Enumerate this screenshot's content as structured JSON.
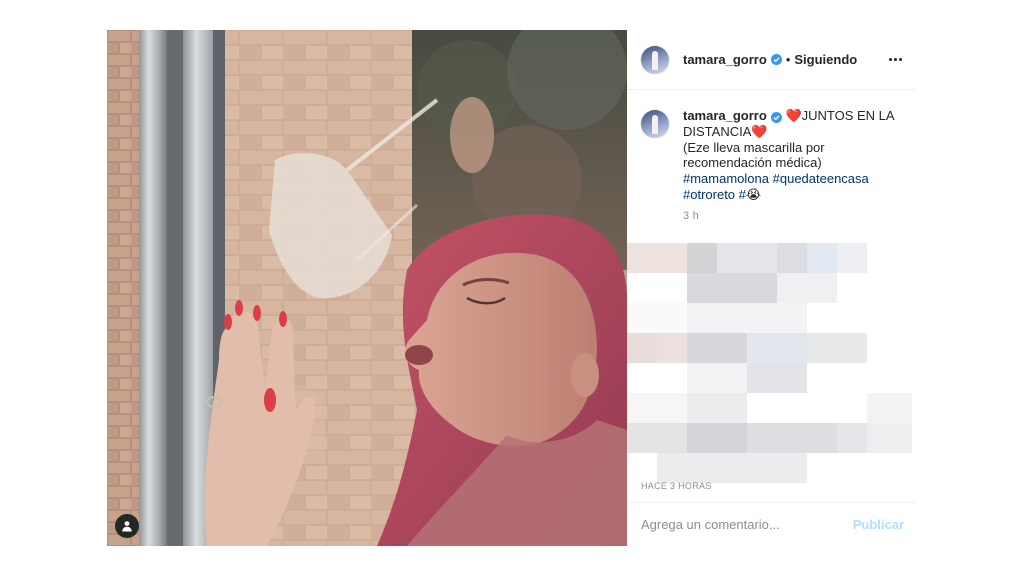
{
  "post": {
    "username": "tamara_gorro",
    "follow_status": "Siguiendo",
    "separator": "•",
    "caption": {
      "emoji_heart": "❤️",
      "line1": "JUNTOS EN LA",
      "line2": "DISTANCIA",
      "line3": "(Eze lleva mascarilla por",
      "line4": "recomendación médica)",
      "hashtag1": "#mamamolona",
      "hashtag2": "#quedateencasa",
      "hashtag3": "#otroreto",
      "hashtag4": "#",
      "crown_emoji": "😭",
      "time": "3 h"
    },
    "posted_ago": "HACE 3 HORAS",
    "comment_placeholder": "Agrega un comentario...",
    "publish_label": "Publicar"
  },
  "colors": {
    "verified": "#3897f0",
    "hashtag": "#003569",
    "publish_disabled": "#b2dffc",
    "heart": "#e0245e"
  },
  "icons": {
    "verified": "verified-badge-icon",
    "more": "more-options-icon",
    "tag": "user-tag-icon"
  }
}
